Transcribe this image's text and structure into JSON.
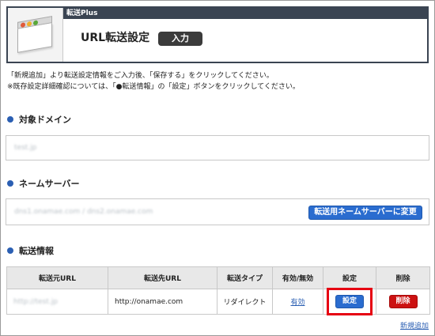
{
  "header": {
    "product": "転送Plus",
    "title": "URL転送設定",
    "badge": "入力"
  },
  "intro": {
    "line1": "「新規追加」より転送設定情報をご入力後、「保存する」をクリックしてください。",
    "line2": "※既存設定詳細確認については、「●転送情報」の「設定」ボタンをクリックしてください。"
  },
  "domain_section": {
    "title": "対象ドメイン",
    "value": "test.jp"
  },
  "nameserver_section": {
    "title": "ネームサーバー",
    "value": "dns1.onamae.com / dns2.onamae.com",
    "change_button": "転送用ネームサーバーに変更"
  },
  "forward_section": {
    "title": "転送情報",
    "columns": [
      "転送元URL",
      "転送先URL",
      "転送タイプ",
      "有効/無効",
      "設定",
      "削除"
    ],
    "rows": [
      {
        "source": "http://test.jp",
        "destination": "http://onamae.com",
        "type": "リダイレクト",
        "status": "有効",
        "settings_button": "設定",
        "delete_button": "削除"
      }
    ],
    "add_new": "新規追加"
  },
  "colors": {
    "header_dark": "#3a4452",
    "accent_blue": "#2a6ccf",
    "delete_red": "#cc1111",
    "highlight_red": "#e60012"
  }
}
